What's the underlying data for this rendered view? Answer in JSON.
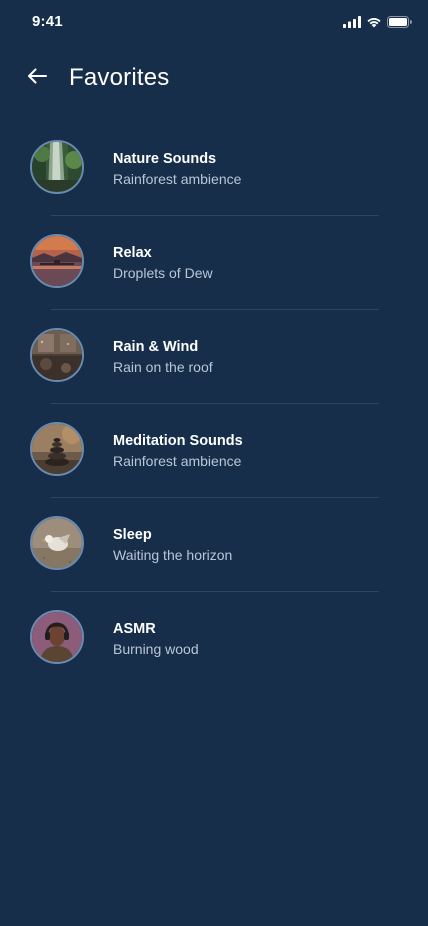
{
  "status_bar": {
    "time": "9:41",
    "icons": [
      "cellular-signal-icon",
      "wifi-icon",
      "battery-icon"
    ]
  },
  "header": {
    "back_icon": "arrow-left-icon",
    "title": "Favorites"
  },
  "colors": {
    "background": "#172e4b",
    "thumb_border": "#6a8bb0",
    "subtitle": "#b9c6d6",
    "divider": "#2b4563"
  },
  "favorites": [
    {
      "title": "Nature Sounds",
      "subtitle": "Rainforest ambience",
      "image": "waterfall-forest-photo"
    },
    {
      "title": "Relax",
      "subtitle": "Droplets of Dew",
      "image": "sunset-lake-photo"
    },
    {
      "title": "Rain & Wind",
      "subtitle": "Rain on the roof",
      "image": "rainy-window-photo"
    },
    {
      "title": "Meditation Sounds",
      "subtitle": "Rainforest ambience",
      "image": "stacked-stones-photo"
    },
    {
      "title": "Sleep",
      "subtitle": "Waiting the horizon",
      "image": "bird-on-sand-photo"
    },
    {
      "title": "ASMR",
      "subtitle": "Burning wood",
      "image": "person-headphones-photo"
    }
  ]
}
